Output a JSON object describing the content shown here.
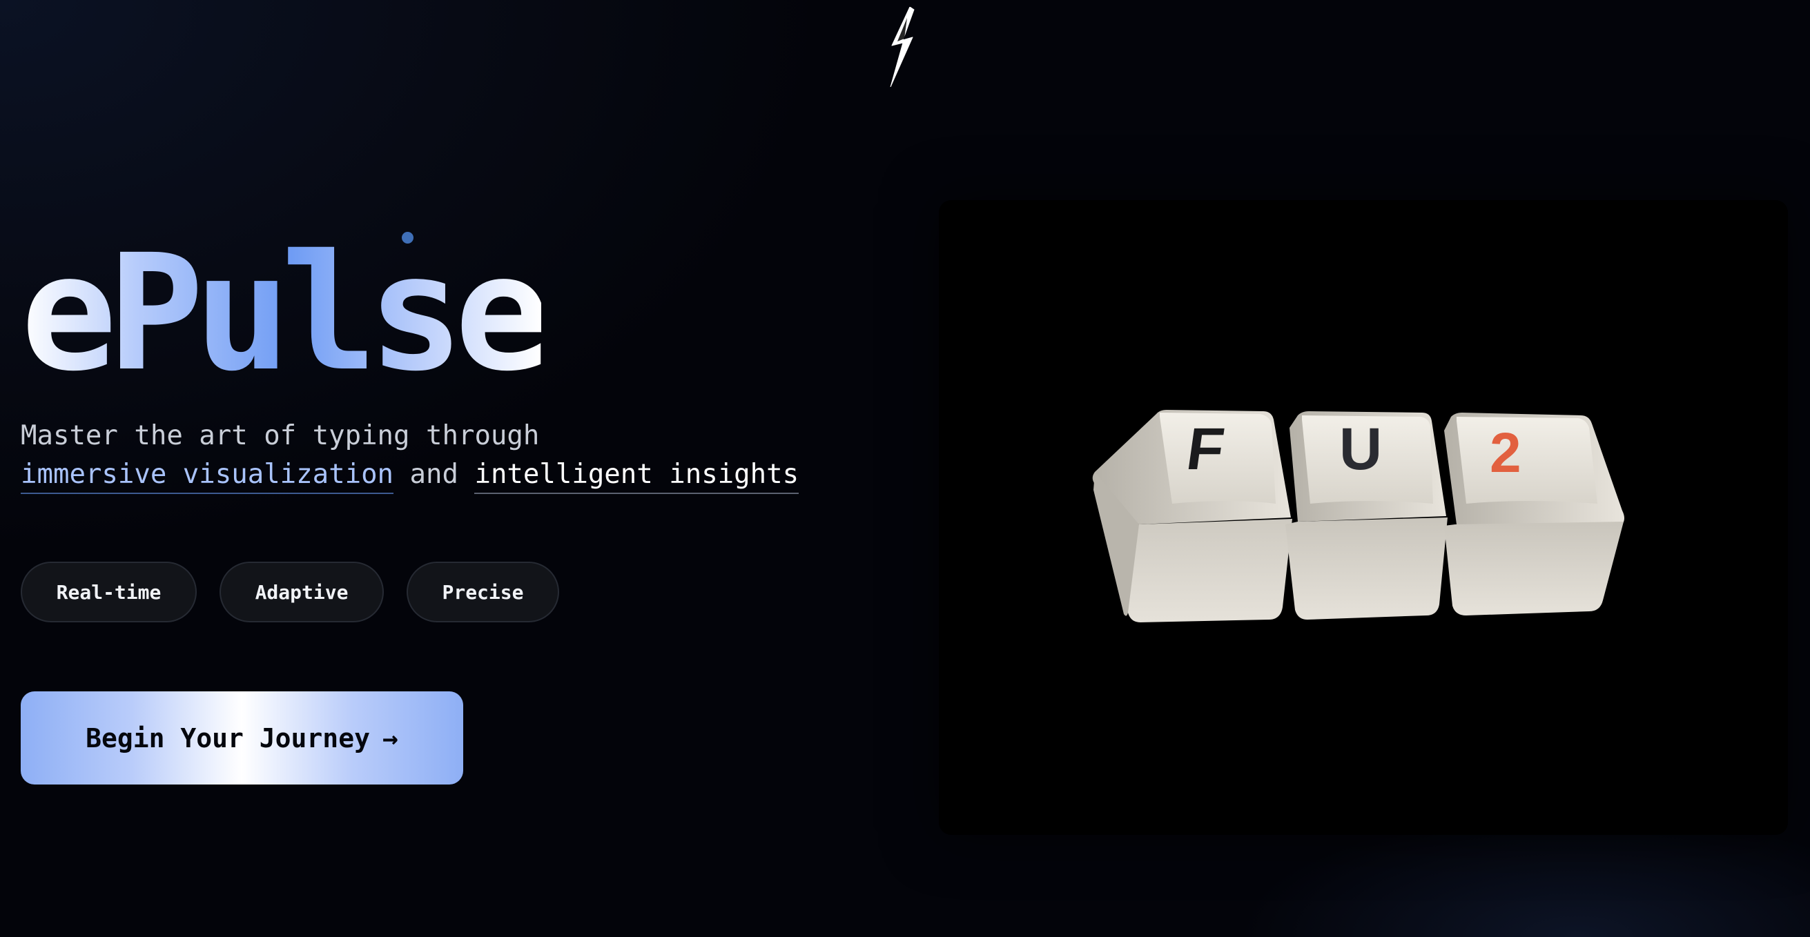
{
  "brand": {
    "name": "ePulse",
    "logo_icon": "lightning-bolt-icon"
  },
  "hero": {
    "tagline_line1": "Master the art of typing through",
    "highlight1": "immersive visualization",
    "connector": "and",
    "highlight2": "intelligent insights"
  },
  "features": [
    {
      "label": "Real-time"
    },
    {
      "label": "Adaptive"
    },
    {
      "label": "Precise"
    }
  ],
  "cta": {
    "label": "Begin Your Journey",
    "arrow": "→"
  },
  "visual": {
    "keycaps": [
      {
        "letter": "F",
        "color": "#1b1b1d"
      },
      {
        "letter": "U",
        "color": "#2a2b31"
      },
      {
        "letter": "2",
        "color": "#e2603f"
      }
    ]
  },
  "colors": {
    "accent": "#8eaff5",
    "accent_dark": "#6f9cf4",
    "background": "#03040a",
    "keycap_accent": "#e2603f"
  }
}
